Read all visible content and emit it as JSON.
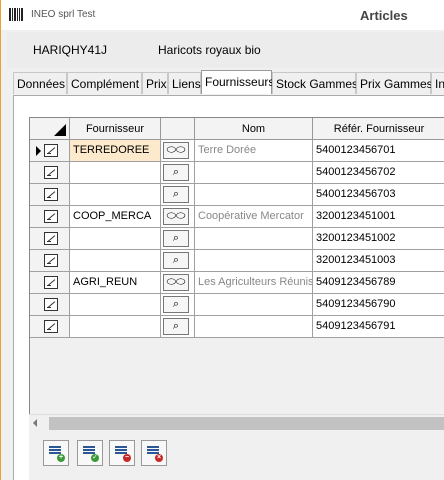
{
  "window": {
    "app_title": "INEO sprl Test",
    "form_title": "Articles"
  },
  "article": {
    "code": "HARIQHY41J",
    "name": "Haricots royaux bio"
  },
  "tabs": [
    {
      "label": "Données",
      "active": false
    },
    {
      "label": "Complément",
      "active": false
    },
    {
      "label": "Prix",
      "active": false
    },
    {
      "label": "Liens",
      "active": false
    },
    {
      "label": "Fournisseurs",
      "active": true
    },
    {
      "label": "Stock Gammes",
      "active": false
    },
    {
      "label": "Prix Gammes",
      "active": false
    },
    {
      "label": "In",
      "active": false
    }
  ],
  "grid": {
    "columns": [
      "Fournisseur",
      "",
      "Nom",
      "Référ. Fournisseur"
    ],
    "rows": [
      {
        "supplier": "TERREDOREE",
        "button": "glasses",
        "name": "Terre Dorée",
        "ref": "5400123456701",
        "current": true
      },
      {
        "supplier": "",
        "button": "search",
        "name": "",
        "ref": "5400123456702",
        "current": false
      },
      {
        "supplier": "",
        "button": "search",
        "name": "",
        "ref": "5400123456703",
        "current": false
      },
      {
        "supplier": "COOP_MERCA",
        "button": "glasses",
        "name": "Coopérative Mercator",
        "ref": "3200123451001",
        "current": false
      },
      {
        "supplier": "",
        "button": "search",
        "name": "",
        "ref": "3200123451002",
        "current": false
      },
      {
        "supplier": "",
        "button": "search",
        "name": "",
        "ref": "3200123451003",
        "current": false
      },
      {
        "supplier": "AGRI_REUN",
        "button": "glasses",
        "name": "Les Agriculteurs Réunis",
        "ref": "5409123456789",
        "current": false
      },
      {
        "supplier": "",
        "button": "search",
        "name": "",
        "ref": "5409123456790",
        "current": false
      },
      {
        "supplier": "",
        "button": "search",
        "name": "",
        "ref": "5409123456791",
        "current": false
      }
    ]
  },
  "icons": {
    "glasses": "⬭⬭",
    "search": "⌕"
  },
  "toolbar": [
    {
      "name": "add-row-icon",
      "color": "#3a9a3a"
    },
    {
      "name": "validate-row-icon",
      "color": "#3a9a3a"
    },
    {
      "name": "remove-row-icon",
      "color": "#c62828"
    },
    {
      "name": "delete-row-icon",
      "color": "#c62828"
    }
  ],
  "colors": {
    "accent": "#f0a030",
    "highlight": "#fde9cc"
  }
}
